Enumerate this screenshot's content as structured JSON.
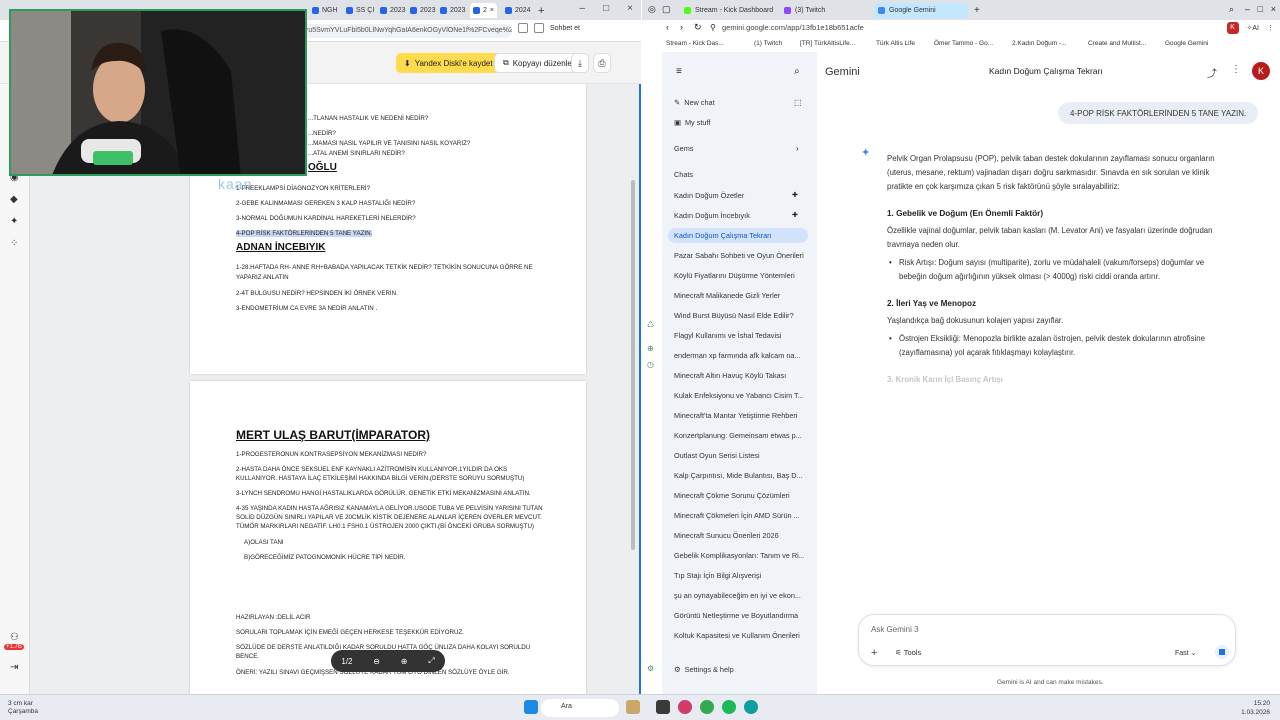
{
  "left_browser": {
    "tabs": [
      "NGH",
      "SS ÇI",
      "2023",
      "2023",
      "2023",
      "2",
      "2024"
    ],
    "url": "ru5SvmYVLuFbi5b0LlNwYqhGaIA6enkOGyVlONe1f%2FCveqe%2...",
    "header_right": "Sohbet et",
    "yandex_save": "Yandex Diski'e kaydet",
    "copy_edit": "Kopyayı düzenle",
    "page1_lines": [
      "...TLANAN HASTALIK VE NEDENİ NEDİR?",
      "...NEDİR?",
      "...MAMASI NASIL YAPILIR VE TANISINI NASIL KOYARIZ?",
      "...ATAL ANEMİ SINIRLARI NEDİR?"
    ],
    "heading_partial": "OĞLU",
    "page1_numbered": [
      "1-PREEKLAMPSİ DİAGNOZYON KRİTERLERİ?",
      "2-GEBE KALINMAMASI GEREKEN 3 KALP HASTALIĞI NEDİR?",
      "3-NORMAL DOĞUMUN KARDİNAL HAREKETLERİ NELERDİR?"
    ],
    "highlighted_line": "4-POP RİSK FAKTÖRLERİNDEN 5 TANE YAZIN.",
    "heading2": "ADNAN İNCEBIYIK",
    "adnan_lines": [
      "1-28.HAFTADA RH- ANNE RH+BABADA YAPILACAK TETKİK NEDİR? TETKİKİN SONUCUNA GÖRRE NE",
      "YAPARIZ ANLATIN",
      "2-4T BULGUSU NEDİR? HEPSİNDEN İKİ ÖRNEK VERİN.",
      "3-ENDOMETRİUM CA EVRE 3A NEDİR ANLATIN ."
    ],
    "heading3": "MERT ULAŞ BARUT(İMPARATOR)",
    "mert_lines": [
      "1-PROGESTERONUN KONTRASEPSİYON MEKANİZMASI NEDİR?",
      "2-HASTA DAHA ÖNCE SEKSUEL ENF KAYNAKLI AZİTROMİSİN KULLANIYOR.1YILDIR DA OKS",
      "KULLANIYOR. HASTAYA İLAÇ ETKİLEŞİMİ HAKKINDA BİLGİ VERİN.(DERSTE SORUYU SORMUŞTU)",
      "3-LYNCH SENDROMU HANGİ HASTALIKLARDA GÖRÜLÜR. GENETİK ETKİ MEKANİZMASINI ANLATIN.",
      "4-35 YAŞINDA KADIN HASTA AĞRISIZ KANAMAYLA GELİYOR.USGDE TUBA VE PELVİSİN YARISINI TUTAN",
      "SOLİD DÜZGÜN SINIRLI YAPILAR VE 20CMLİK KİSTİK DEJENERE ALANLAR İÇEREN OVERLER MEVCUT.",
      "TÜMÖR MARKIRLARI NEGATİF. LH0.1 FSH0.1 ÜSTROJEN 2000 ÇIKTI.(Bİ ÖNCEKİ GRUBA SORMUŞTU)",
      "A)OLASI TANI",
      "B)GÖRECEĞİMİZ PATOGNOMONİK HÜCRE TİPİ NEDİR."
    ],
    "footer_lines": [
      "HAZIRLAYAN :DELİL ACIR",
      "SORULARI TOPLAMAK İÇİN EMEĞİ GEÇEN HERKESE TEŞEKKÜR EDİYORUZ.",
      "SÖZLÜDE DE DERSTE ANLATILDIĞI KADAR SORULDU HATTA GÖÇ ÜNLIZA DAHA KOLAYI SORULDU",
      "BENCE.",
      "ÖNERİ: YAZILI SINAVI GEÇMİŞSEN SÖZLÜYE KADAR TÜM GYO DİNLEN SÖZLÜYE ÖYLE GİR."
    ],
    "page_indicator": "1/2",
    "cam_overlay_text": "kaan",
    "left_badge": "+1.7B"
  },
  "right_browser": {
    "tabs": [
      "Stream - Kick Dashboard",
      "(3) Twitch",
      "Google Gemini"
    ],
    "url": "gemini.google.com/app/13fb1e18b651acfe",
    "bookmarks": [
      "Stream - Kick Das...",
      "(1) Twitch",
      "[TR] TürkAltisLife...",
      "Türk Altis Life",
      "Ömer Tammo - Go...",
      "2.Kadın Doğum -...",
      "Create and Multist...",
      "Google Gemini"
    ],
    "avatar_letter": "K",
    "ai_label": "AI"
  },
  "gemini": {
    "brand": "Gemini",
    "conversation_title": "Kadın Doğum Çalışma Tekrarı",
    "new_chat": "New chat",
    "my_stuff": "My stuff",
    "gems": "Gems",
    "chats_label": "Chats",
    "chats": [
      "Kadın Doğum Özetler",
      "Kadın Doğum İncebıyık",
      "Kadın Doğum Çalışma Tekrarı",
      "Pazar Sabahı Sohbeti ve Oyun Önerileri",
      "Köylü Fiyatlarını Düşürme Yöntemleri",
      "Minecraft Malikanede Gizli Yerler",
      "Wind Burst Büyüsü Nasıl Elde Edilir?",
      "Flagyl Kullanımı ve İshal Tedavisi",
      "enderman xp farmında afk kalcam na...",
      "Minecraft Altın Havuç Köylü Takası",
      "Kulak Enfeksiyonu ve Yabancı Cisim T...",
      "Minecraft'ta Mantar Yetiştirme Rehberi",
      "Konzertplanung: Gemeinsam etwas p...",
      "Outlast Oyun Serisi Listesi",
      "Kalp Çarpıntısı, Mide Bulantısı, Baş D...",
      "Minecraft Çökme Sorunu Çözümleri",
      "Minecraft Çökmeleri İçin AMD Sürün ...",
      "Minecraft Sunucu Önerileri 2026",
      "Gebelik Komplikasyonları: Tanım ve Ri...",
      "Tıp Stajı İçin Bilgi Alışverişi",
      "şu an oynayabileceğim en iyi ve ekon...",
      "Görüntü Netleştirme ve Boyutlandırma",
      "Koltuk Kapasitesi ve Kullanım Önerileri"
    ],
    "settings": "Settings & help",
    "user_prompt": "4-POP RİSK FAKTÖRLERİNDEN 5 TANE YAZIN.",
    "response": {
      "intro1": "Pelvik Organ Prolapsusu (POP), pelvik taban destek dokularının zayıflaması sonucu organların",
      "intro2": "(uterus, mesane, rektum) vajinadan dışarı doğru sarkmasıdır. Sınavda en sık sorulan ve klinik",
      "intro3": "pratikte en çok karşımıza çıkan 5 risk faktörünü şöyle sıralayabiliriz:",
      "h1": "1. Gebelik ve Doğum (En Önemli Faktör)",
      "p1a": "Özellikle vajinal doğumlar, pelvik taban kasları (M. Levator Ani) ve fasyaları üzerinde doğrudan",
      "p1b": "travmaya neden olur.",
      "b1a": "Risk Artışı: Doğum sayısı (multiparite), zorlu ve müdahaleli (vakum/forseps) doğumlar ve",
      "b1b": "bebeğin doğum ağırlığının yüksek olması (> 4000g) riski ciddi oranda artırır.",
      "h2": "2. İleri Yaş ve Menopoz",
      "p2": "Yaşlandıkça bağ dokusunun kolajen yapısı zayıflar.",
      "b2a": "Östrojen Eksikliği: Menopozla birlikte azalan östrojen, pelvik destek dokularının atrofisine",
      "b2b": "(zayıflamasına) yol açarak fıtıklaşmayı kolaylaştırır.",
      "h3": "3. Kronik Karın İçi Basınç Artışı"
    },
    "input_placeholder": "Ask Gemini 3",
    "tools": "Tools",
    "mode": "Fast",
    "disclaimer": "Gemini is AI and can make mistakes."
  },
  "taskbar": {
    "weather_temp": "3 cm kar",
    "weather_day": "Çarşamba",
    "search": "Ara",
    "time": "15:20",
    "date": "1.03.2026"
  }
}
